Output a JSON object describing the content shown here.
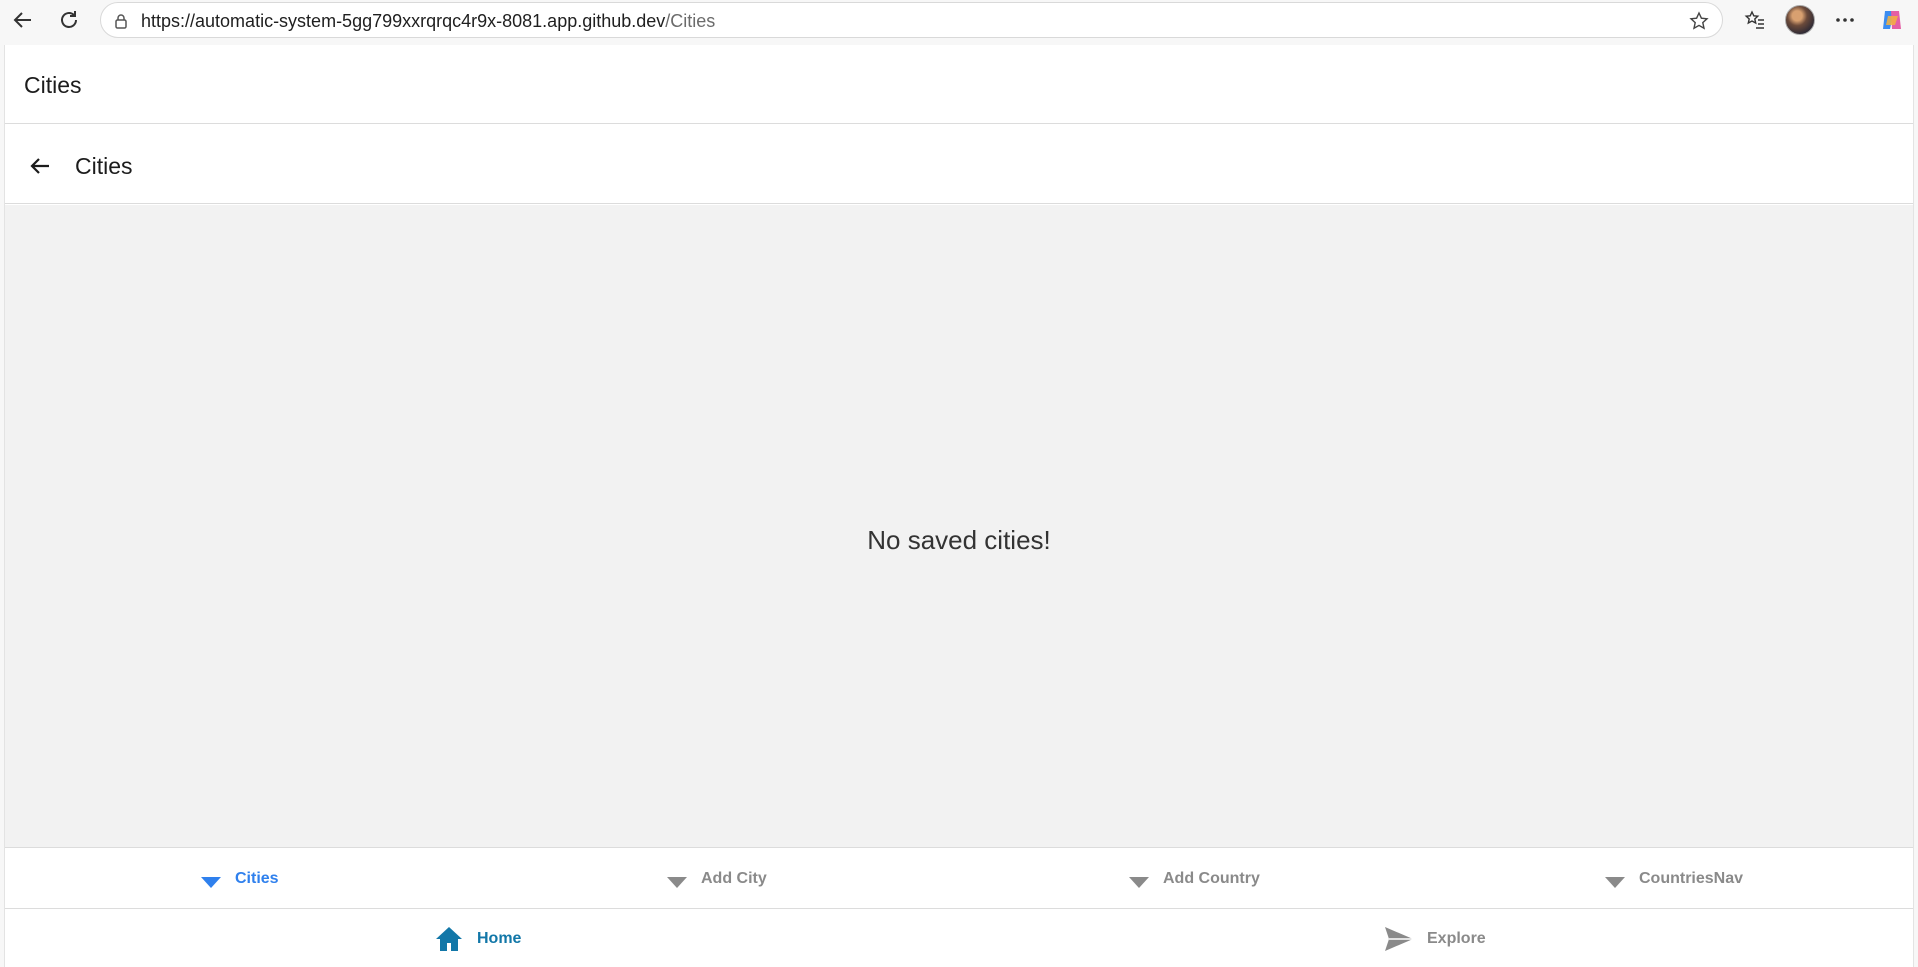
{
  "browser": {
    "url_host": "https://automatic-system-5gg799xxrqrqc4r9x-8081.app.github.dev",
    "url_path": "/Cities"
  },
  "app": {
    "title": "Cities"
  },
  "subheader": {
    "title": "Cities"
  },
  "content": {
    "empty_message": "No saved cities!"
  },
  "top_tabs": [
    {
      "label": "Cities",
      "active": true
    },
    {
      "label": "Add City",
      "active": false
    },
    {
      "label": "Add Country",
      "active": false
    },
    {
      "label": "CountriesNav",
      "active": false
    }
  ],
  "bottom_tabs": [
    {
      "label": "Home",
      "icon": "home-icon",
      "active": true
    },
    {
      "label": "Explore",
      "icon": "send-icon",
      "active": false
    }
  ],
  "colors": {
    "active_tab": "#2f80ed",
    "active_bottom": "#1277a8",
    "inactive": "#8a8a8a"
  }
}
